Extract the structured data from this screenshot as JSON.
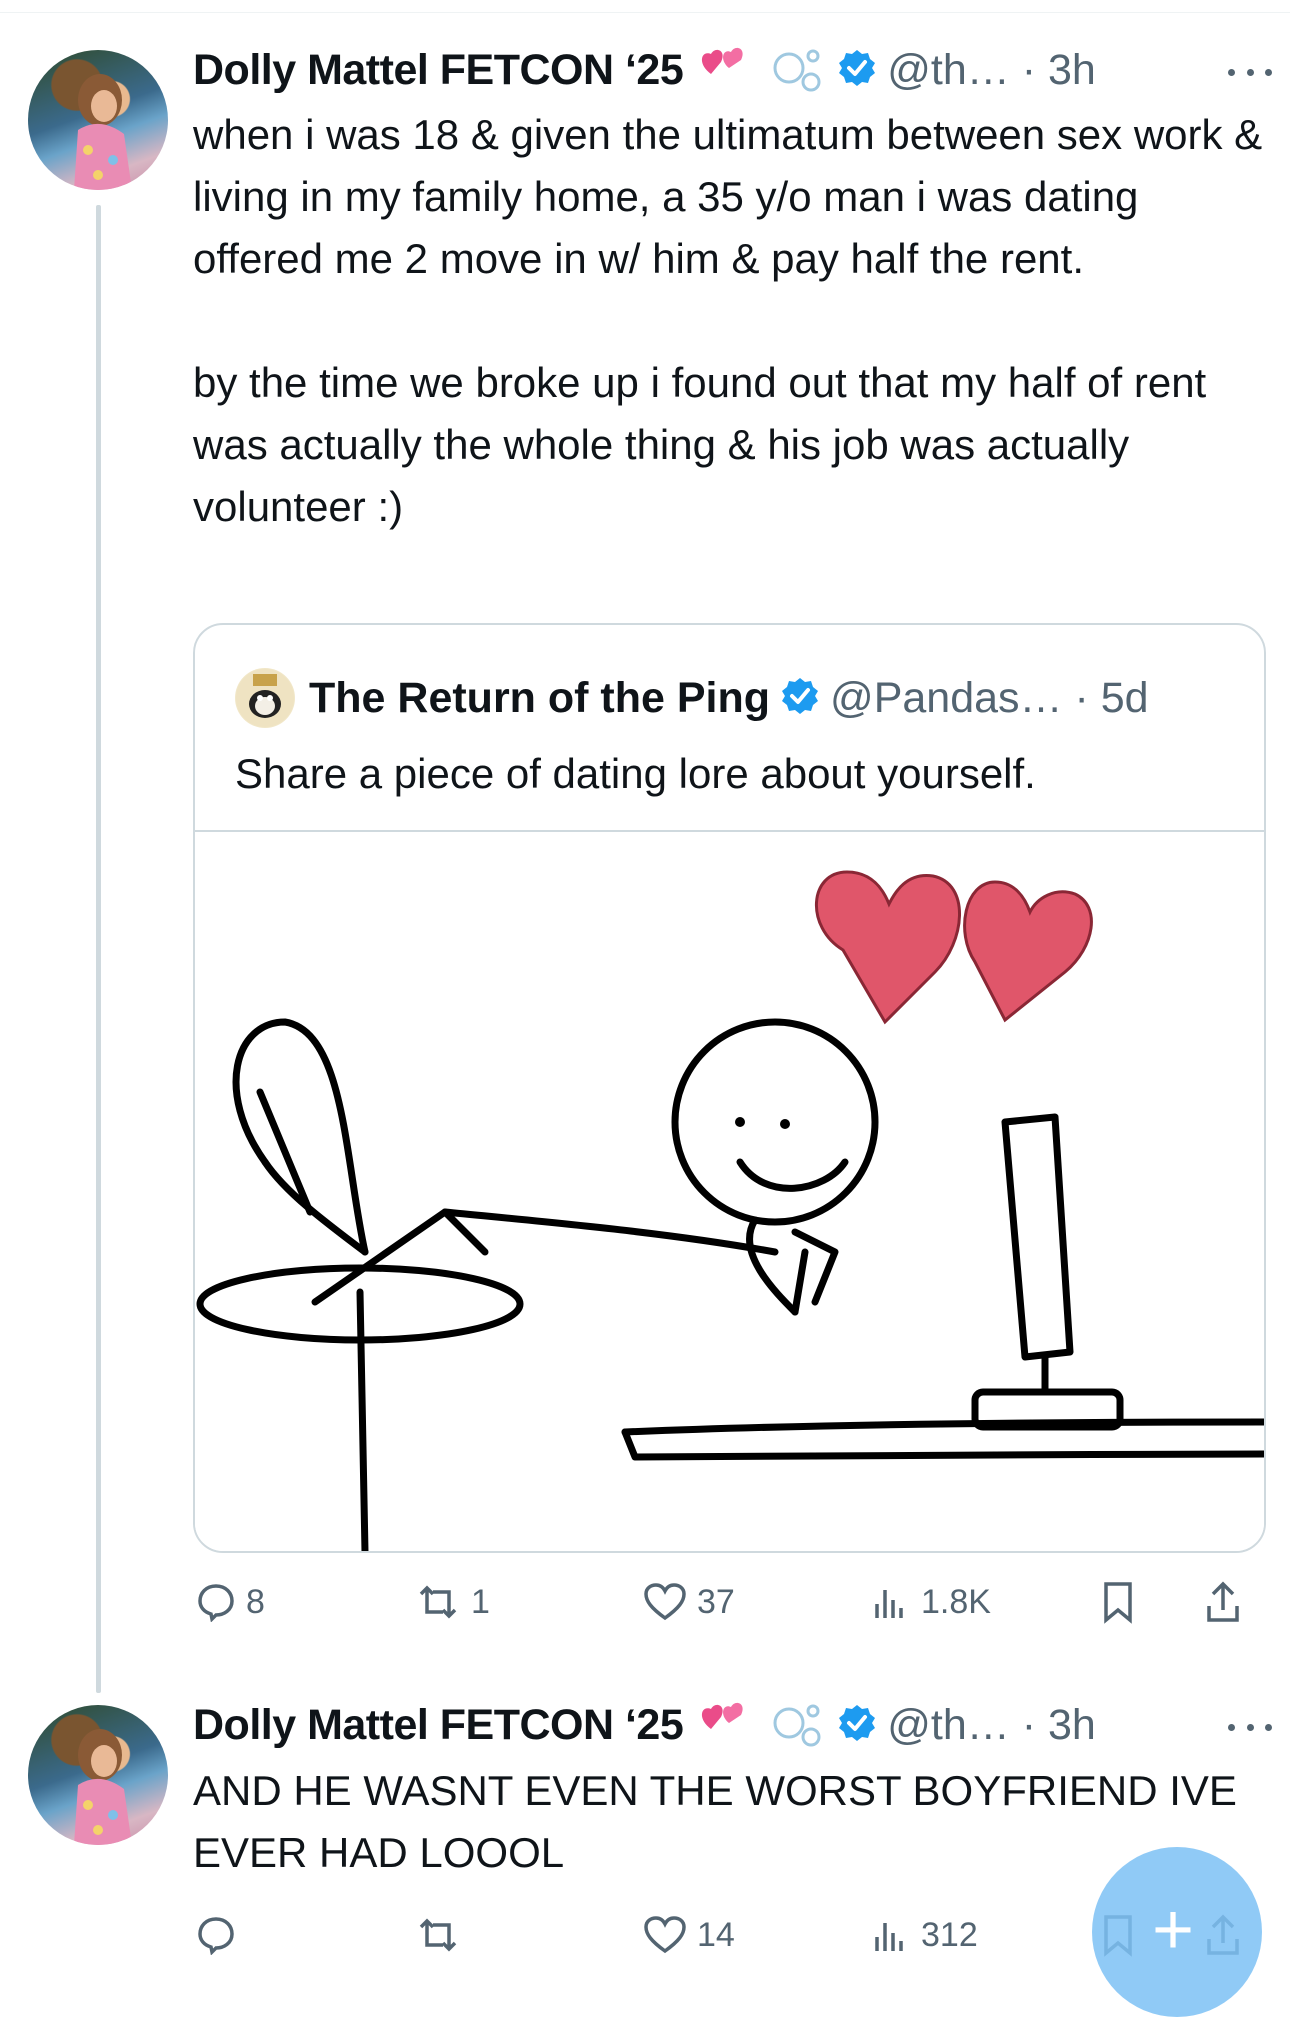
{
  "thread": [
    {
      "author_name": "Dolly Mattel FETCON ‘25",
      "handle": "@th… · 3h",
      "text": "when i was 18 & given the ultimatum between sex work & living in my family home, a 35 y/o man i was dating offered me 2 move in w/ him & pay half the rent.\n\nby the time we broke up i found out that my half of rent was actually the whole thing & his job was actually volunteer :)",
      "quote": {
        "author_name": "The Return of the Ping",
        "handle": "@Pandas… · 5d",
        "text": "Share a piece of dating lore about yourself."
      },
      "actions": {
        "replies": "8",
        "reposts": "1",
        "likes": "37",
        "views": "1.8K"
      }
    },
    {
      "author_name": "Dolly Mattel FETCON ‘25",
      "handle": "@th… · 3h",
      "text": "AND HE WASNT EVEN THE WORST BOYFRIEND IVE EVER HAD LOOOL",
      "actions": {
        "replies": "",
        "reposts": "",
        "likes": "14",
        "views": "312"
      }
    }
  ],
  "icons": [
    "more-icon",
    "verified-badge-icon",
    "reply-icon",
    "repost-icon",
    "like-icon",
    "views-icon",
    "bookmark-icon",
    "share-icon",
    "compose-plus-icon"
  ],
  "colors": {
    "verified": "#1d9bf0",
    "muted_text": "#536471",
    "heart": "#e0566a",
    "fab": "#7cc1f5"
  }
}
